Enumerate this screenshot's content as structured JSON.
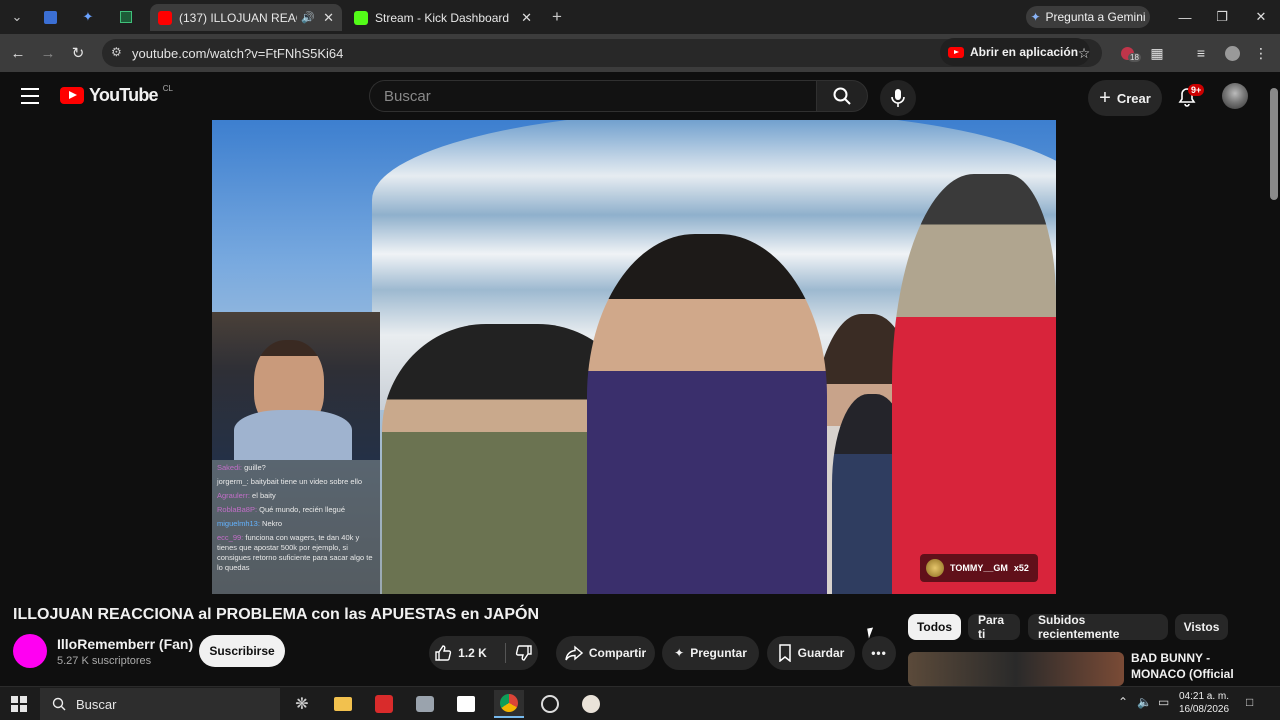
{
  "browser": {
    "tabs": [
      {
        "title": "(137) ILLOJUAN REACCION…",
        "active": true
      },
      {
        "title": "Stream - Kick Dashboard",
        "active": false
      }
    ],
    "gemini_label": "Pregunta a Gemini",
    "url": "youtube.com/watch?v=FtFNhS5Ki64",
    "open_in_app": "Abrir en aplicación",
    "ext_badge": "18"
  },
  "youtube": {
    "region": "CL",
    "logo_word": "YouTube",
    "search_placeholder": "Buscar",
    "create_label": "Crear",
    "notif_badge": "9+"
  },
  "video": {
    "overlay_user": "TOMMY__GM",
    "overlay_count": "x52",
    "chat": [
      {
        "user": "Sakedi:",
        "msg": "guille?"
      },
      {
        "user": "jorgerm_:",
        "msg": "baitybait tiene un video sobre ello"
      },
      {
        "user": "Agraulerr:",
        "msg": "el baity"
      },
      {
        "user": "RoblaBa8P:",
        "msg": "Qué mundo, recién llegué"
      },
      {
        "user": "miguelmh13:",
        "msg": "Nekro"
      },
      {
        "user": "ecc_99:",
        "msg": "funciona con wagers, te dan 40k y tienes que apostar 500k por ejemplo, si consigues retorno suficiente para sacar algo te lo quedas"
      }
    ]
  },
  "meta": {
    "title": "ILLOJUAN REACCIONA al PROBLEMA con las APUESTAS en JAPÓN",
    "channel": "IlloRememberr (Fan)",
    "subscribers": "5.27 K suscriptores",
    "subscribe_label": "Suscribirse",
    "likes": "1.2 K",
    "share_label": "Compartir",
    "ask_label": "Preguntar",
    "save_label": "Guardar"
  },
  "chips": [
    "Todos",
    "Para ti",
    "Subidos recientemente",
    "Vistos"
  ],
  "related": {
    "title": "BAD BUNNY - MONACO (Official"
  },
  "taskbar": {
    "search_label": "Buscar",
    "time": "04:21 a. m.",
    "date": "16/08/2026"
  },
  "colors": {
    "brand_red": "#ff0000",
    "channel_avatar": "#ff00f2"
  }
}
